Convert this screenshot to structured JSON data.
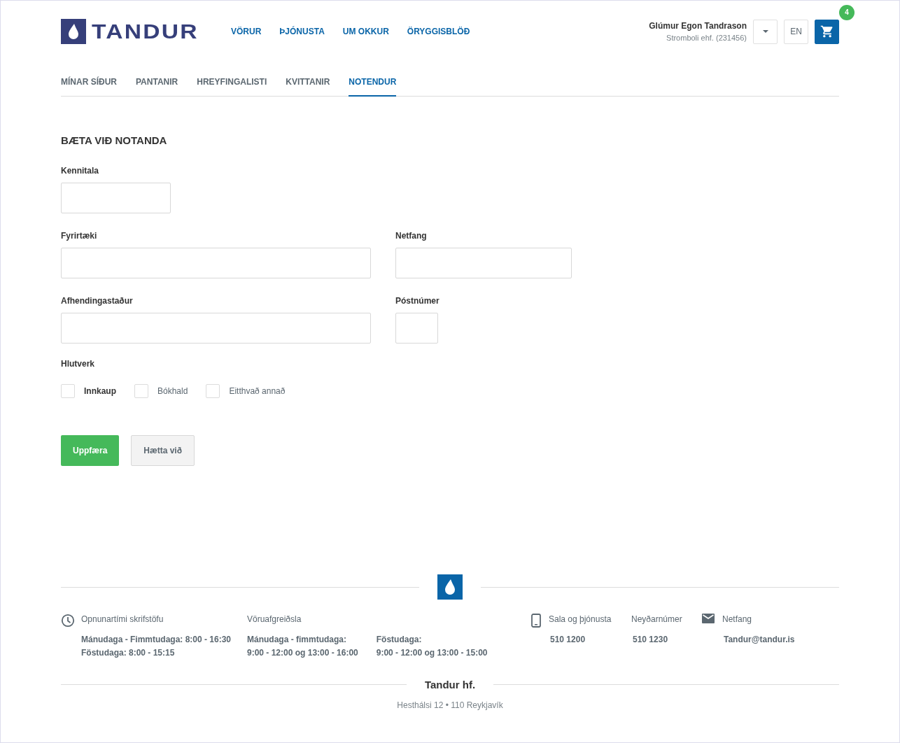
{
  "header": {
    "logo_text": "TANDUR",
    "nav": [
      "VÖRUR",
      "ÞJÓNUSTA",
      "UM OKKUR",
      "ÖRYGGISBLÖÐ"
    ],
    "user": {
      "name": "Glúmur Egon Tandrason",
      "company": "Stromboli ehf. (231456)"
    },
    "language": "EN",
    "cart_count": "4"
  },
  "tabs": [
    {
      "label": "MÍNAR SÍÐUR",
      "selected": false
    },
    {
      "label": "PANTANIR",
      "selected": false
    },
    {
      "label": "HREYFINGALISTI",
      "selected": false
    },
    {
      "label": "KVITTANIR",
      "selected": false
    },
    {
      "label": "NOTENDUR",
      "selected": true
    }
  ],
  "form": {
    "title": "BÆTA VIÐ NOTANDA",
    "fields": [
      {
        "label": "Kennitala",
        "kind": "id"
      },
      {
        "label": "Fyrirtæki",
        "kind": "text"
      },
      {
        "label": "Netfang",
        "kind": "email"
      },
      {
        "label": "Afhendingastaður",
        "kind": "text"
      },
      {
        "label": "Póstnúmer",
        "kind": "postal"
      }
    ],
    "roles_label": "Hlutverk",
    "roles": [
      {
        "label": "Innkaup",
        "checked": false,
        "highlighted": true
      },
      {
        "label": "Bókhald",
        "checked": false,
        "highlighted": false
      },
      {
        "label": "Eitthvað annað",
        "checked": false,
        "highlighted": false
      }
    ],
    "buttons": [
      {
        "label": "Uppfæra",
        "kind": "primary"
      },
      {
        "label": "Hætta við",
        "kind": "secondary"
      }
    ]
  },
  "footer": {
    "office": {
      "title": "Opnunartími skrifstöfu",
      "lines": [
        "Mánudaga - Fimmtudaga: 8:00 - 16:30",
        "Föstudaga: 8:00 - 15:15"
      ]
    },
    "delivery": {
      "title": "Vöruafgreiðsla",
      "columns": [
        [
          "Mánudaga - fimmtudaga:",
          "9:00 - 12:00 og 13:00 - 16:00"
        ],
        [
          "Föstudaga:",
          "9:00 - 12:00 og 13:00 - 15:00"
        ]
      ]
    },
    "contacts": [
      {
        "label": "Sala og þjónusta",
        "value": "510 1200",
        "kind": "phone"
      },
      {
        "label": "Neyðarnúmer",
        "value": "510 1230",
        "kind": "plain"
      },
      {
        "label": "Netfang",
        "value": "Tandur@tandur.is",
        "kind": "mail"
      }
    ],
    "company": "Tandur hf.",
    "address": "Hesthálsi 12 • 110 Reykjavík"
  }
}
